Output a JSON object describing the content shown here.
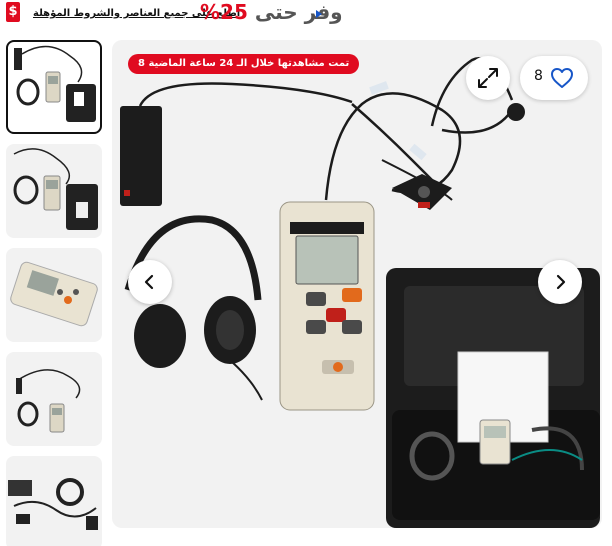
{
  "promo": {
    "badge": "$",
    "save_label": "وفر حتى",
    "save_value": "25%",
    "terms": "اطلع على جميع العناصر والشروط المؤهلة"
  },
  "gallery": {
    "views_badge": "تمت مشاهدتها خلال الـ 24 ساعة الماضية 8",
    "favorites_count": "8",
    "thumbnails": [
      "thumb-1",
      "thumb-2",
      "thumb-3",
      "thumb-4",
      "thumb-5"
    ],
    "selected_thumbnail_index": 0
  },
  "colors": {
    "accent_red": "#e00b20",
    "link_blue": "#1756c8",
    "heart_blue": "#1756c8"
  },
  "icons": {
    "expand": "expand-icon",
    "heart": "heart-icon",
    "prev": "chevron-left-icon",
    "next": "chevron-right-icon"
  }
}
